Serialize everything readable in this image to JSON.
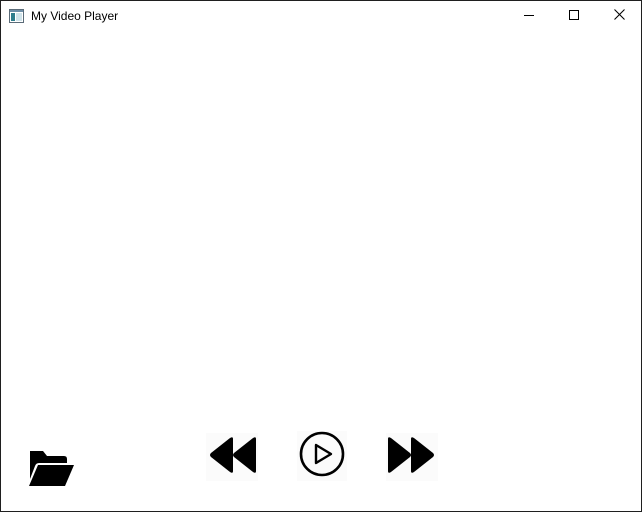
{
  "window": {
    "title": "My Video Player",
    "icon": "app-window-icon",
    "caption_buttons": [
      "minimize-icon",
      "maximize-icon",
      "close-icon"
    ]
  },
  "controls": {
    "open": {
      "icon": "folder-open-icon"
    },
    "rewind": {
      "icon": "rewind-icon"
    },
    "play": {
      "icon": "play-circle-icon"
    },
    "forward": {
      "icon": "fast-forward-icon"
    }
  },
  "colors": {
    "background": "#ffffff",
    "border": "#1f1f1f",
    "icon": "#000000"
  }
}
